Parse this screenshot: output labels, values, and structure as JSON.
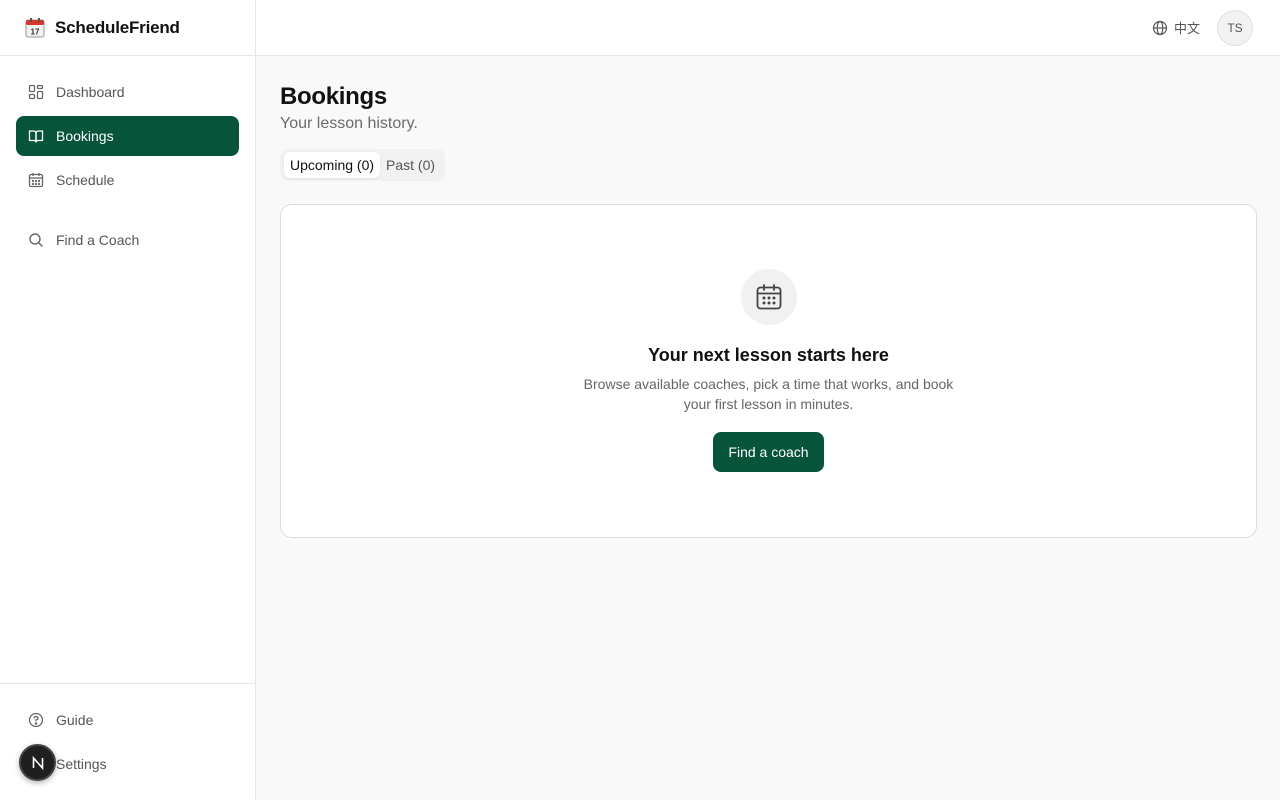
{
  "app": {
    "name": "ScheduleFriend"
  },
  "sidebar": {
    "items": [
      {
        "label": "Dashboard",
        "icon": "dashboard-icon"
      },
      {
        "label": "Bookings",
        "icon": "book-icon",
        "active": true
      },
      {
        "label": "Schedule",
        "icon": "calendar-icon"
      },
      {
        "label": "Find a Coach",
        "icon": "search-icon"
      }
    ],
    "bottom": [
      {
        "label": "Guide",
        "icon": "help-circle-icon"
      },
      {
        "label": "Settings",
        "icon": "gear-icon"
      }
    ]
  },
  "header": {
    "language": "中文",
    "avatar_initials": "TS"
  },
  "page": {
    "title": "Bookings",
    "subtitle": "Your lesson history."
  },
  "tabs": [
    {
      "label": "Upcoming (0)",
      "active": true
    },
    {
      "label": "Past (0)"
    }
  ],
  "empty_state": {
    "title": "Your next lesson starts here",
    "description": "Browse available coaches, pick a time that works, and book your first lesson in minutes.",
    "button": "Find a coach"
  },
  "colors": {
    "accent": "#06543a",
    "background": "#f8f9f8"
  }
}
